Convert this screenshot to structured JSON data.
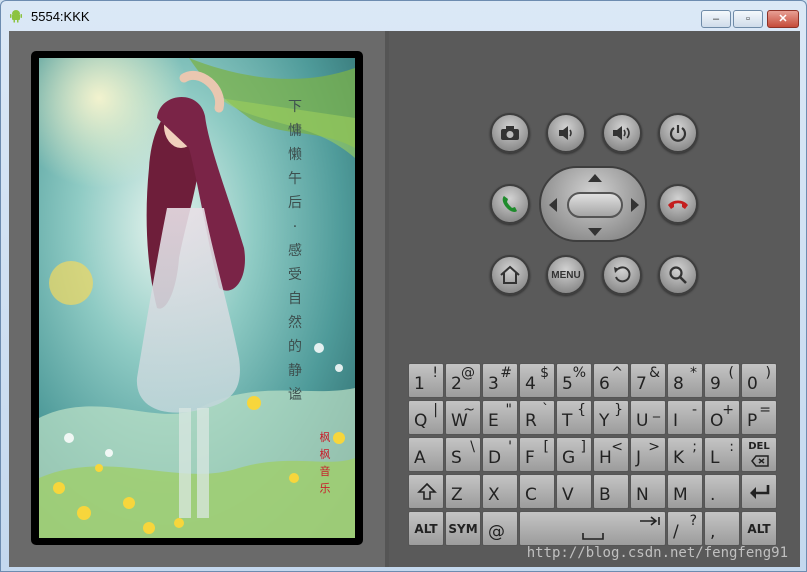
{
  "window": {
    "title": "5554:KKK"
  },
  "screen": {
    "poem": [
      "下",
      "慵",
      "懒",
      "午",
      "后",
      "·",
      "感",
      "受",
      "自",
      "然",
      "的",
      "静",
      "谧"
    ],
    "stamp": [
      "枫",
      "枫",
      "音",
      "乐"
    ]
  },
  "controls": {
    "row1": [
      "camera-icon",
      "volume-down-icon",
      "volume-up-icon",
      "power-icon"
    ],
    "menu_label": "MENU"
  },
  "keyboard": {
    "row1": [
      {
        "m": "1",
        "s": "!"
      },
      {
        "m": "2",
        "s": "@"
      },
      {
        "m": "3",
        "s": "#"
      },
      {
        "m": "4",
        "s": "$"
      },
      {
        "m": "5",
        "s": "%"
      },
      {
        "m": "6",
        "s": "^"
      },
      {
        "m": "7",
        "s": "&"
      },
      {
        "m": "8",
        "s": "*"
      },
      {
        "m": "9",
        "s": "("
      },
      {
        "m": "0",
        "s": ")"
      }
    ],
    "row2": [
      {
        "m": "Q",
        "s": "|"
      },
      {
        "m": "W",
        "s": "~"
      },
      {
        "m": "E",
        "s": "\""
      },
      {
        "m": "R",
        "s": "`"
      },
      {
        "m": "T",
        "s": "{"
      },
      {
        "m": "Y",
        "s": "}"
      },
      {
        "m": "U",
        "s": "_"
      },
      {
        "m": "I",
        "s": "-"
      },
      {
        "m": "O",
        "s": "+"
      },
      {
        "m": "P",
        "s": "="
      }
    ],
    "row3": [
      {
        "m": "A",
        "s": ""
      },
      {
        "m": "S",
        "s": "\\"
      },
      {
        "m": "D",
        "s": "'"
      },
      {
        "m": "F",
        "s": "["
      },
      {
        "m": "G",
        "s": "]"
      },
      {
        "m": "H",
        "s": "<"
      },
      {
        "m": "J",
        "s": ">"
      },
      {
        "m": "K",
        "s": ";"
      },
      {
        "m": "L",
        "s": ":"
      }
    ],
    "del_label": "DEL",
    "row4": [
      {
        "m": "Z"
      },
      {
        "m": "X"
      },
      {
        "m": "C"
      },
      {
        "m": "V"
      },
      {
        "m": "B"
      },
      {
        "m": "N"
      },
      {
        "m": "M"
      },
      {
        "m": "."
      }
    ],
    "alt_label": "ALT",
    "sym_label": "SYM",
    "at_label": "@",
    "slash": {
      "m": "/",
      "s": "?"
    },
    "comma": {
      "m": ",",
      "s": ""
    }
  },
  "watermark": "http://blog.csdn.net/fengfeng91"
}
